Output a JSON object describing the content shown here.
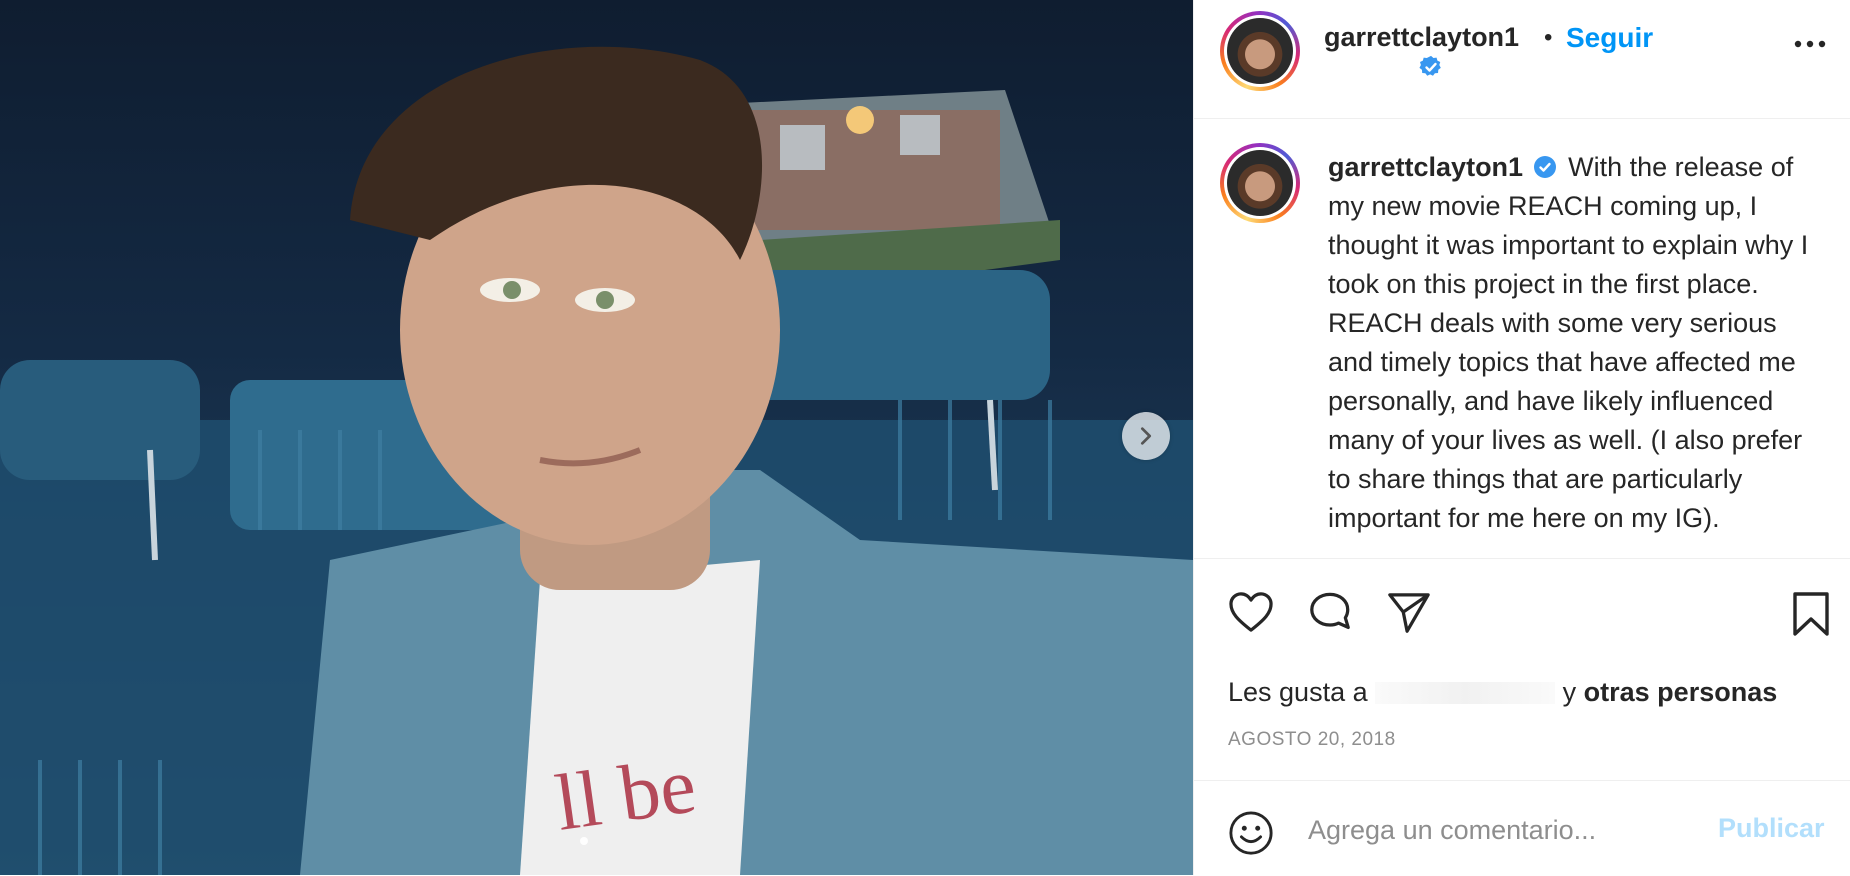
{
  "post": {
    "username": "garrettclayton1",
    "follow_label": "Seguir",
    "separator": "•",
    "verified": true,
    "caption": "With the release of my new movie REACH coming up, I thought it was important to explain why I took on this project in the first place. REACH deals with some very serious and timely topics that have affected me personally, and have likely influenced many of your lives as well. (I also prefer to share things that are particularly important for me here on my IG).",
    "likes_prefix": "Les gusta a",
    "likes_and": "y",
    "likes_others": "otras personas",
    "date": "AGOSTO 20, 2018"
  },
  "comment": {
    "placeholder": "Agrega un comentario...",
    "publish_label": "Publicar"
  },
  "icons": {
    "more": "more-icon",
    "next": "chevron-right-icon",
    "like": "heart-icon",
    "comment": "comment-icon",
    "share": "send-icon",
    "save": "bookmark-icon",
    "emoji": "emoji-icon",
    "verified": "verified-badge-icon"
  },
  "colors": {
    "accent": "#0095f6",
    "publish_disabled": "#b2dffc",
    "verified": "#3897f0",
    "muted": "#8e8e8e"
  }
}
